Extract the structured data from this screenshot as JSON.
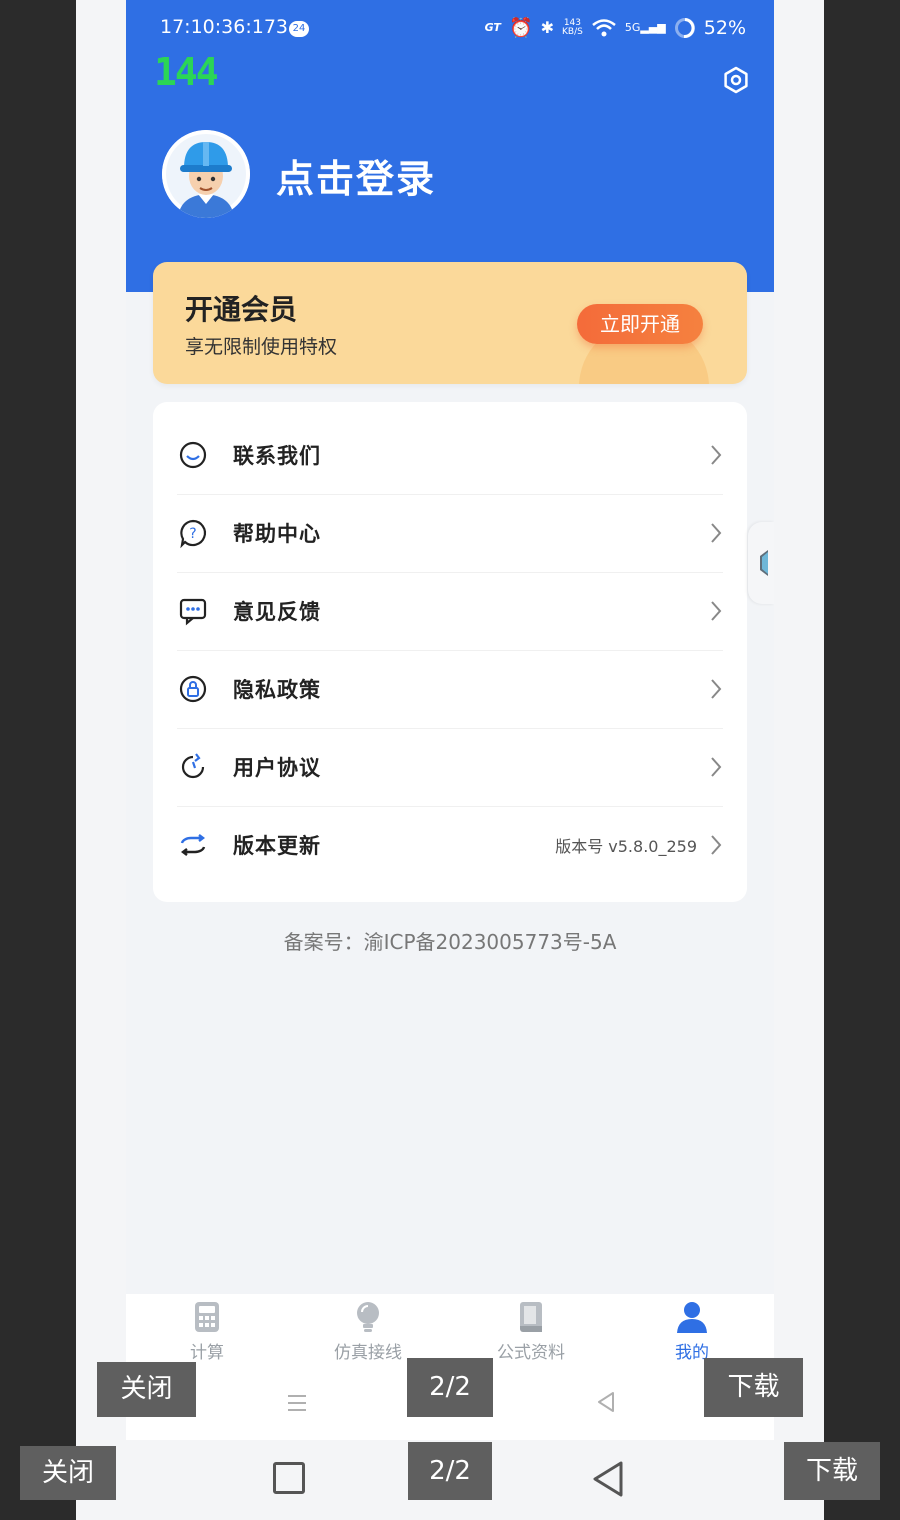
{
  "status_bar": {
    "time": "17:10:36:173",
    "time_badge": "24",
    "network_speed_top": "143",
    "network_speed_bottom": "KB/S",
    "signal_label": "5G",
    "battery": "52%"
  },
  "fps_counter": "144",
  "profile": {
    "login_text": "点击登录"
  },
  "vip": {
    "title": "开通会员",
    "subtitle": "享无限制使用特权",
    "button": "立即开通"
  },
  "menu": {
    "items": [
      {
        "label": "联系我们",
        "icon": "chat-icon"
      },
      {
        "label": "帮助中心",
        "icon": "help-icon"
      },
      {
        "label": "意见反馈",
        "icon": "feedback-icon"
      },
      {
        "label": "隐私政策",
        "icon": "privacy-lock-icon"
      },
      {
        "label": "用户协议",
        "icon": "agreement-refresh-icon"
      },
      {
        "label": "版本更新",
        "icon": "update-sync-icon",
        "value": "版本号 v5.8.0_259"
      }
    ]
  },
  "icp": "备案号：渝ICP备2023005773号-5A",
  "tabbar": {
    "tabs": [
      {
        "label": "计算",
        "icon": "calculator-icon"
      },
      {
        "label": "仿真接线",
        "icon": "bulb-icon"
      },
      {
        "label": "公式资料",
        "icon": "book-icon"
      },
      {
        "label": "我的",
        "icon": "user-icon"
      }
    ],
    "active_color": "#2f6fe4"
  },
  "overlay": {
    "close_label": "关闭",
    "page_indicator": "2/2",
    "download_label": "下载"
  },
  "colors": {
    "header_blue": "#2f6fe4",
    "vip_bg": "#fbd99a",
    "vip_button": "#f46b3a",
    "fps_green": "#2bd556"
  }
}
